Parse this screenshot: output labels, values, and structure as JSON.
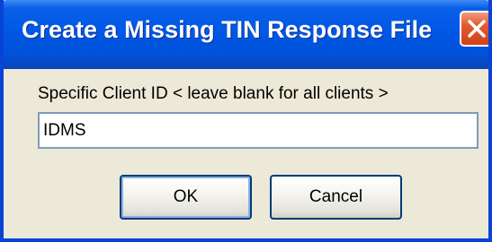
{
  "window": {
    "title": "Create a Missing TIN Response File"
  },
  "form": {
    "client_id_label": "Specific Client ID < leave blank for all clients >",
    "client_id_value": "IDMS"
  },
  "buttons": {
    "ok_label": "OK",
    "cancel_label": "Cancel"
  },
  "icons": {
    "close": "close-icon"
  },
  "colors": {
    "titlebar": "#0058E6",
    "dialog_face": "#ECE9D8",
    "close_button": "#E2592F"
  }
}
